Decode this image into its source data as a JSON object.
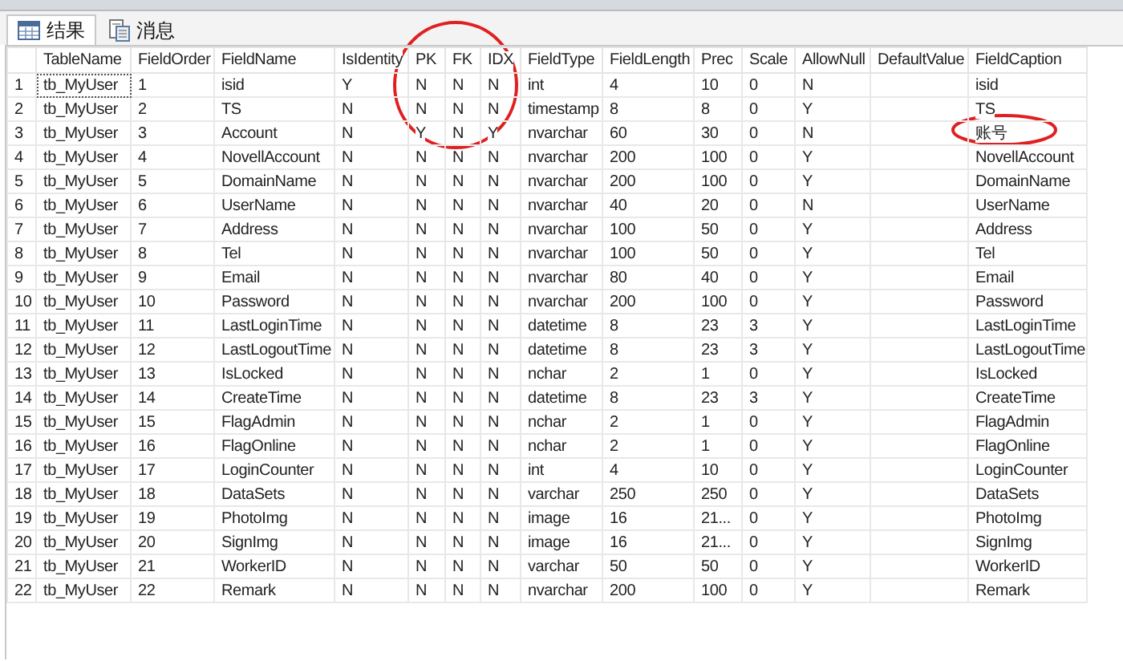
{
  "tabs": [
    {
      "label": "结果",
      "kind": "grid",
      "selected": true
    },
    {
      "label": "消息",
      "kind": "doc",
      "selected": false
    }
  ],
  "table": {
    "columns": [
      "",
      "TableName",
      "FieldOrder",
      "FieldName",
      "IsIdentity",
      "PK",
      "FK",
      "IDX",
      "FieldType",
      "FieldLength",
      "Prec",
      "Scale",
      "AllowNull",
      "DefaultValue",
      "FieldCaption"
    ],
    "rows": [
      [
        "1",
        "tb_MyUser",
        "1",
        "isid",
        "Y",
        "N",
        "N",
        "N",
        "int",
        "4",
        "10",
        "0",
        "N",
        "",
        "isid"
      ],
      [
        "2",
        "tb_MyUser",
        "2",
        "TS",
        "N",
        "N",
        "N",
        "N",
        "timestamp",
        "8",
        "8",
        "0",
        "Y",
        "",
        "TS"
      ],
      [
        "3",
        "tb_MyUser",
        "3",
        "Account",
        "N",
        "Y",
        "N",
        "Y",
        "nvarchar",
        "60",
        "30",
        "0",
        "N",
        "",
        "账号"
      ],
      [
        "4",
        "tb_MyUser",
        "4",
        "NovellAccount",
        "N",
        "N",
        "N",
        "N",
        "nvarchar",
        "200",
        "100",
        "0",
        "Y",
        "",
        "NovellAccount"
      ],
      [
        "5",
        "tb_MyUser",
        "5",
        "DomainName",
        "N",
        "N",
        "N",
        "N",
        "nvarchar",
        "200",
        "100",
        "0",
        "Y",
        "",
        "DomainName"
      ],
      [
        "6",
        "tb_MyUser",
        "6",
        "UserName",
        "N",
        "N",
        "N",
        "N",
        "nvarchar",
        "40",
        "20",
        "0",
        "N",
        "",
        "UserName"
      ],
      [
        "7",
        "tb_MyUser",
        "7",
        "Address",
        "N",
        "N",
        "N",
        "N",
        "nvarchar",
        "100",
        "50",
        "0",
        "Y",
        "",
        "Address"
      ],
      [
        "8",
        "tb_MyUser",
        "8",
        "Tel",
        "N",
        "N",
        "N",
        "N",
        "nvarchar",
        "100",
        "50",
        "0",
        "Y",
        "",
        "Tel"
      ],
      [
        "9",
        "tb_MyUser",
        "9",
        "Email",
        "N",
        "N",
        "N",
        "N",
        "nvarchar",
        "80",
        "40",
        "0",
        "Y",
        "",
        "Email"
      ],
      [
        "10",
        "tb_MyUser",
        "10",
        "Password",
        "N",
        "N",
        "N",
        "N",
        "nvarchar",
        "200",
        "100",
        "0",
        "Y",
        "",
        "Password"
      ],
      [
        "11",
        "tb_MyUser",
        "11",
        "LastLoginTime",
        "N",
        "N",
        "N",
        "N",
        "datetime",
        "8",
        "23",
        "3",
        "Y",
        "",
        "LastLoginTime"
      ],
      [
        "12",
        "tb_MyUser",
        "12",
        "LastLogoutTime",
        "N",
        "N",
        "N",
        "N",
        "datetime",
        "8",
        "23",
        "3",
        "Y",
        "",
        "LastLogoutTime"
      ],
      [
        "13",
        "tb_MyUser",
        "13",
        "IsLocked",
        "N",
        "N",
        "N",
        "N",
        "nchar",
        "2",
        "1",
        "0",
        "Y",
        "",
        "IsLocked"
      ],
      [
        "14",
        "tb_MyUser",
        "14",
        "CreateTime",
        "N",
        "N",
        "N",
        "N",
        "datetime",
        "8",
        "23",
        "3",
        "Y",
        "",
        "CreateTime"
      ],
      [
        "15",
        "tb_MyUser",
        "15",
        "FlagAdmin",
        "N",
        "N",
        "N",
        "N",
        "nchar",
        "2",
        "1",
        "0",
        "Y",
        "",
        "FlagAdmin"
      ],
      [
        "16",
        "tb_MyUser",
        "16",
        "FlagOnline",
        "N",
        "N",
        "N",
        "N",
        "nchar",
        "2",
        "1",
        "0",
        "Y",
        "",
        "FlagOnline"
      ],
      [
        "17",
        "tb_MyUser",
        "17",
        "LoginCounter",
        "N",
        "N",
        "N",
        "N",
        "int",
        "4",
        "10",
        "0",
        "Y",
        "",
        "LoginCounter"
      ],
      [
        "18",
        "tb_MyUser",
        "18",
        "DataSets",
        "N",
        "N",
        "N",
        "N",
        "varchar",
        "250",
        "250",
        "0",
        "Y",
        "",
        "DataSets"
      ],
      [
        "19",
        "tb_MyUser",
        "19",
        "PhotoImg",
        "N",
        "N",
        "N",
        "N",
        "image",
        "16",
        "21...",
        "0",
        "Y",
        "",
        "PhotoImg"
      ],
      [
        "20",
        "tb_MyUser",
        "20",
        "SignImg",
        "N",
        "N",
        "N",
        "N",
        "image",
        "16",
        "21...",
        "0",
        "Y",
        "",
        "SignImg"
      ],
      [
        "21",
        "tb_MyUser",
        "21",
        "WorkerID",
        "N",
        "N",
        "N",
        "N",
        "varchar",
        "50",
        "50",
        "0",
        "Y",
        "",
        "WorkerID"
      ],
      [
        "22",
        "tb_MyUser",
        "22",
        "Remark",
        "N",
        "N",
        "N",
        "N",
        "nvarchar",
        "200",
        "100",
        "0",
        "Y",
        "",
        "Remark"
      ]
    ]
  }
}
